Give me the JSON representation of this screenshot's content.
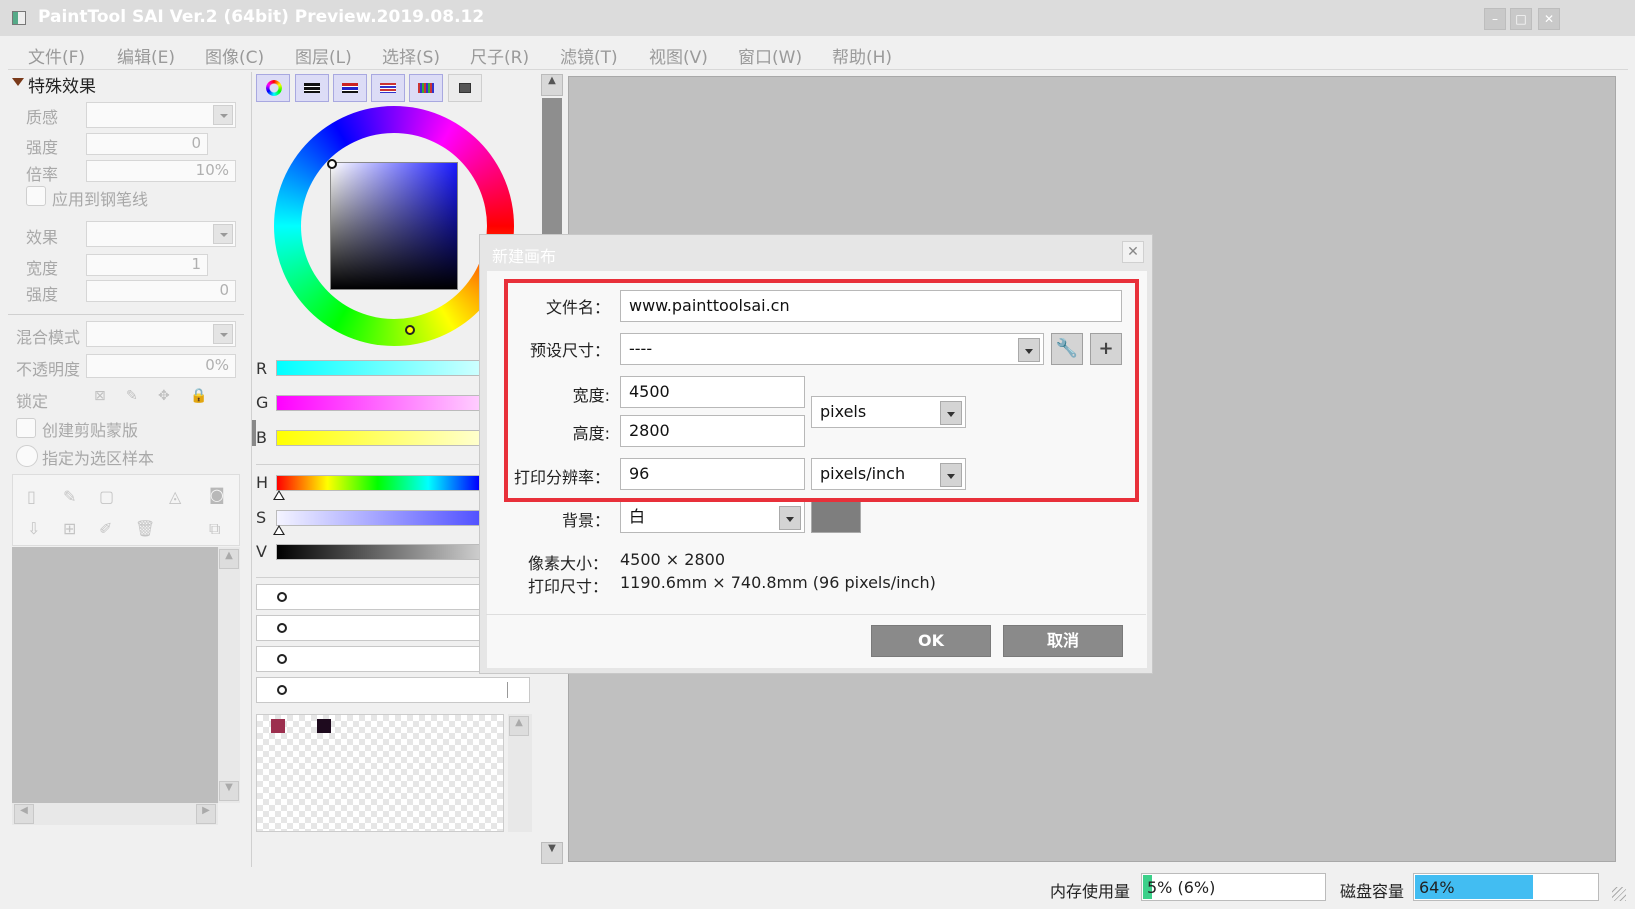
{
  "window": {
    "title": "PaintTool SAI Ver.2 (64bit) Preview.2019.08.12",
    "controls": [
      "minimize-icon",
      "maximize-icon",
      "close-icon"
    ]
  },
  "menu": [
    {
      "label": "文件(F)",
      "key": "F"
    },
    {
      "label": "编辑(E)",
      "key": "E"
    },
    {
      "label": "图像(C)",
      "key": "C"
    },
    {
      "label": "图层(L)",
      "key": "L"
    },
    {
      "label": "选择(S)",
      "key": "S"
    },
    {
      "label": "尺子(R)",
      "key": "R"
    },
    {
      "label": "滤镜(T)",
      "key": "T"
    },
    {
      "label": "视图(V)",
      "key": "V"
    },
    {
      "label": "窗口(W)",
      "key": "W"
    },
    {
      "label": "帮助(H)",
      "key": "H"
    }
  ],
  "effects_panel": {
    "header": "特殊效果",
    "texture_label": "质感",
    "texture_value": "",
    "strength1_label": "强度",
    "strength1_value": "0",
    "scale_label": "倍率",
    "scale_value": "10%",
    "apply_to_pen_label": "应用到钢笔线",
    "effect_label": "效果",
    "effect_value": "",
    "width_label": "宽度",
    "width_value": "1",
    "strength2_label": "强度",
    "strength2_value": "0",
    "blend_mode_label": "混合模式",
    "blend_mode_value": "",
    "opacity_label": "不透明度",
    "opacity_value": "0%",
    "lock_label": "锁定",
    "clipping_label": "创建剪贴蒙版",
    "selection_source_label": "指定为选区样本"
  },
  "color_panel": {
    "sliders_rgb": [
      "R",
      "G",
      "B"
    ],
    "sliders_hsv": [
      "H",
      "S",
      "V"
    ],
    "swatch_colors": [
      "#9c2f4e",
      "#1e0a1e"
    ]
  },
  "dialog": {
    "title": "新建画布",
    "filename_label": "文件名：",
    "filename_value": "www.painttoolsai.cn",
    "preset_label": "预设尺寸：",
    "preset_value": "----",
    "width_label": "宽度:",
    "width_value": "4500",
    "height_label": "高度:",
    "height_value": "2800",
    "size_unit": "pixels",
    "resolution_label": "打印分辨率：",
    "resolution_value": "96",
    "resolution_unit": "pixels/inch",
    "background_label": "背景：",
    "background_value": "白",
    "pixel_size_label": "像素大小：",
    "pixel_size_value": "4500 × 2800",
    "print_size_label": "打印尺寸：",
    "print_size_value": "1190.6mm × 740.8mm (96 pixels/inch)",
    "ok_label": "OK",
    "cancel_label": "取消",
    "highlight_color": "#e8303a"
  },
  "status": {
    "memory_label": "内存使用量",
    "memory_text": "5% (6%)",
    "memory_fraction": 0.05,
    "memory_color": "#3cd08a",
    "disk_label": "磁盘容量",
    "disk_text": "64%",
    "disk_fraction": 0.64,
    "disk_color": "#42bdf2"
  }
}
